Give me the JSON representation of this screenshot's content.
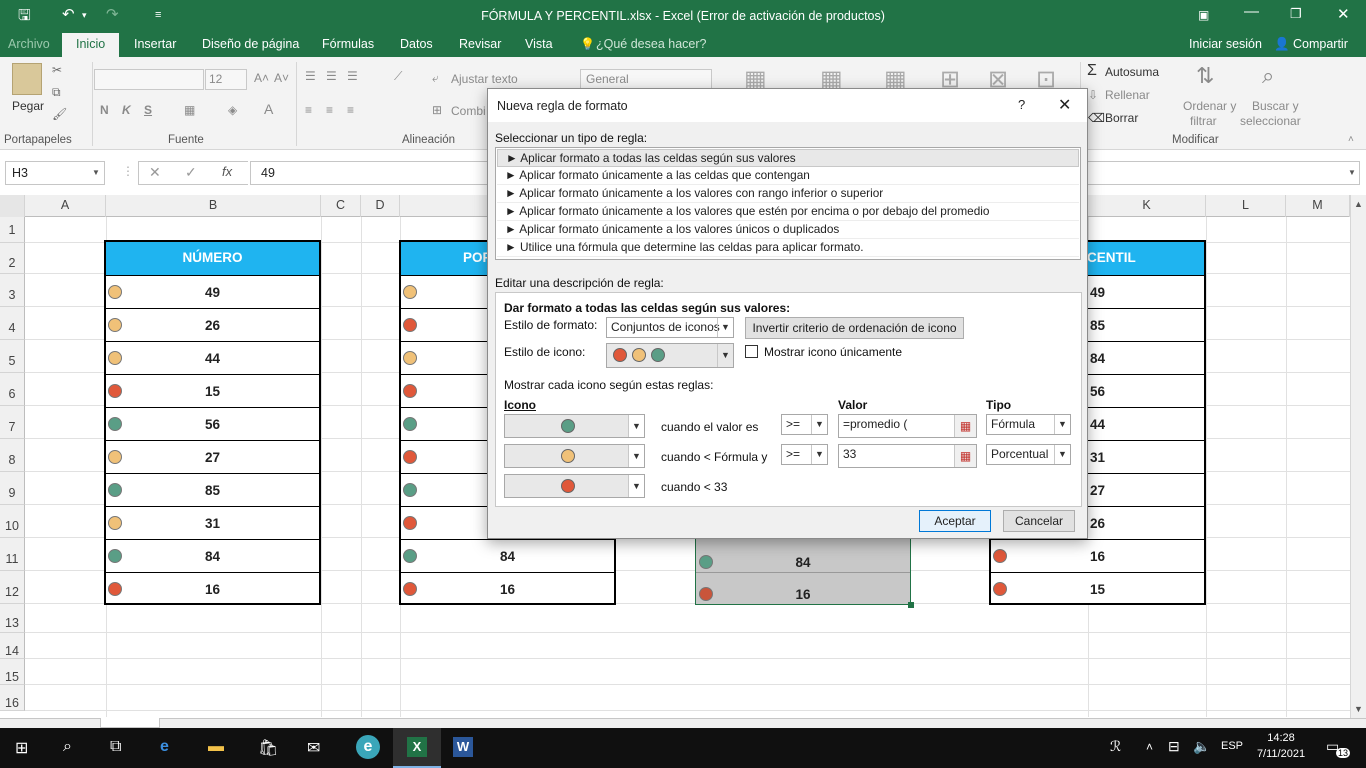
{
  "window": {
    "title": "FÓRMULA Y PERCENTIL.xlsx - Excel (Error de activación de productos)"
  },
  "tabs": [
    {
      "label": "Archivo"
    },
    {
      "label": "Inicio"
    },
    {
      "label": "Insertar"
    },
    {
      "label": "Diseño de página"
    },
    {
      "label": "Fórmulas"
    },
    {
      "label": "Datos"
    },
    {
      "label": "Revisar"
    },
    {
      "label": "Vista"
    },
    {
      "label": "¿Qué desea hacer?"
    }
  ],
  "account": {
    "signin": "Iniciar sesión",
    "share": "Compartir"
  },
  "ribbon": {
    "paste": "Pegar",
    "font_size": "12",
    "bold": "N",
    "italic": "K",
    "underline": "S",
    "wrap_text": "Ajustar texto",
    "combine": "Combi",
    "number_format": "General",
    "autosum": "Autosuma",
    "fill": "Rellenar",
    "clear": "Borrar",
    "sort": "Ordenar y",
    "sort2": "filtrar",
    "find": "Buscar y",
    "find2": "seleccionar",
    "groups": {
      "clipboard": "Portapapeles",
      "font": "Fuente",
      "alignment": "Alineación",
      "edit": "Modificar"
    }
  },
  "formula_bar": {
    "name_box": "H3",
    "value": "49"
  },
  "columns": [
    "A",
    "B",
    "C",
    "D",
    "K",
    "L",
    "M"
  ],
  "rows": [
    "1",
    "2",
    "3",
    "4",
    "5",
    "6",
    "7",
    "8",
    "9",
    "10",
    "11",
    "12",
    "13",
    "14",
    "15",
    "16"
  ],
  "colors": {
    "green": "#5a9e86",
    "yellow": "#f0c178",
    "red": "#e0583a",
    "header": "#1fb4f0",
    "excel": "#217346"
  },
  "table_b": {
    "header": "NÚMERO",
    "rows": [
      {
        "v": "49",
        "icon": "yellow"
      },
      {
        "v": "26",
        "icon": "yellow"
      },
      {
        "v": "44",
        "icon": "yellow"
      },
      {
        "v": "15",
        "icon": "red"
      },
      {
        "v": "56",
        "icon": "green"
      },
      {
        "v": "27",
        "icon": "yellow"
      },
      {
        "v": "85",
        "icon": "green"
      },
      {
        "v": "31",
        "icon": "yellow"
      },
      {
        "v": "84",
        "icon": "green"
      },
      {
        "v": "16",
        "icon": "red"
      }
    ]
  },
  "table_e": {
    "header": "POR",
    "icons": [
      "yellow",
      "red",
      "yellow",
      "red",
      "green",
      "red",
      "green",
      "red",
      "green",
      "red"
    ],
    "visible": {
      "r11": "84",
      "r12": "16"
    }
  },
  "table_h": {
    "r11": "84",
    "r12": "16"
  },
  "table_k": {
    "header": "CENTIL",
    "values": [
      "49",
      "85",
      "84",
      "56",
      "44",
      "31",
      "27",
      "26",
      "16",
      "15"
    ],
    "icons_visible": [
      "red",
      "red"
    ]
  },
  "dialog": {
    "title": "Nueva regla de formato",
    "help": "?",
    "select_type_label": "Seleccionar un tipo de regla:",
    "rule_types": [
      "► Aplicar formato a todas las celdas según sus valores",
      "► Aplicar formato únicamente a las celdas que contengan",
      "► Aplicar formato únicamente a los valores con rango inferior o superior",
      "► Aplicar formato únicamente a los valores que estén por encima o por debajo del promedio",
      "► Aplicar formato únicamente a los valores únicos o duplicados",
      "► Utilice una fórmula que determine las celdas para aplicar formato."
    ],
    "edit_label": "Editar una descripción de regla:",
    "desc_title": "Dar formato a todas las celdas según sus valores:",
    "format_style_label": "Estilo de formato:",
    "format_style_value": "Conjuntos de iconos",
    "reverse_button": "Invertir criterio de ordenación de icono",
    "icon_style_label": "Estilo de icono:",
    "show_icon_only": "Mostrar icono únicamente",
    "rules_caption": "Mostrar cada icono según estas reglas:",
    "col_icon": "Icono",
    "col_value": "Valor",
    "col_type": "Tipo",
    "rules": [
      {
        "icon": "green",
        "text": "cuando el valor es",
        "op": ">=",
        "value": "=promedio (",
        "type": "Fórmula"
      },
      {
        "icon": "yellow",
        "text": "cuando < Fórmula y",
        "op": ">=",
        "value": "33",
        "type": "Porcentual"
      },
      {
        "icon": "red",
        "text": "cuando < 33"
      }
    ],
    "ok": "Aceptar",
    "cancel": "Cancelar"
  },
  "taskbar": {
    "time": "14:28",
    "date": "7/11/2021",
    "lang": "ESP",
    "notifications": "13"
  }
}
